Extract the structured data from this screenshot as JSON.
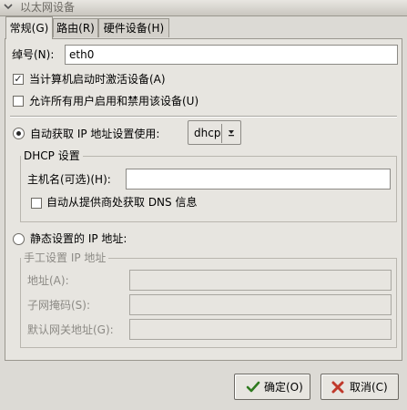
{
  "window": {
    "title": "以太网设备"
  },
  "tabs": [
    {
      "label": "常规(G)",
      "mnemonic": "G",
      "active": true
    },
    {
      "label": "路由(R)",
      "mnemonic": "R",
      "active": false
    },
    {
      "label": "硬件设备(H)",
      "mnemonic": "H",
      "active": false
    }
  ],
  "general": {
    "nickname_label": "绰号(N):",
    "nickname_value": "eth0",
    "activate_on_boot_label": "当计算机启动时激活设备(A)",
    "activate_on_boot_checked": true,
    "allow_users_label": "允许所有用户启用和禁用该设备(U)",
    "allow_users_checked": false,
    "auto_ip_label": "自动获取 IP 地址设置使用:",
    "auto_ip_selected": true,
    "auto_ip_method": "dhcp",
    "dhcp_frame_title": "DHCP 设置",
    "hostname_label": "主机名(可选)(H):",
    "hostname_value": "",
    "auto_dns_label": "自动从提供商处获取 DNS 信息",
    "auto_dns_checked": false,
    "static_ip_label": "静态设置的 IP 地址:",
    "static_ip_selected": false,
    "manual_frame_title": "手工设置 IP 地址",
    "address_label": "地址(A):",
    "netmask_label": "子网掩码(S):",
    "gateway_label": "默认网关地址(G):"
  },
  "buttons": {
    "ok_label": "确定(O)",
    "cancel_label": "取消(C)"
  },
  "icons": {
    "titlebar": "chevron-down-icon",
    "combo_arrow": "arrow-down-icon",
    "ok": "checkmark-icon",
    "cancel": "x-icon"
  },
  "colors": {
    "ok_icon": "#2f7a1f",
    "cancel_icon": "#c0392b"
  }
}
